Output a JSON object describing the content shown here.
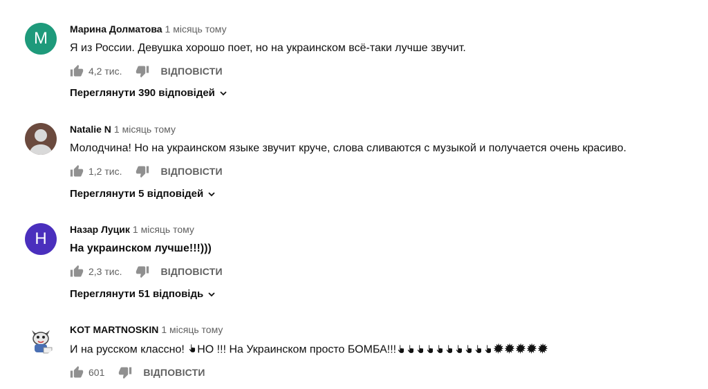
{
  "comments": [
    {
      "author": "Марина Долматова",
      "time": "1 місяць тому",
      "avatar_letter": "M",
      "avatar_color": "#1e9a7b",
      "text": "Я из России. Девушка хорошо поет, но на украинском всё-таки лучше звучит.",
      "likes": "4,2 тис.",
      "reply_label": "ВІДПОВІСТИ",
      "view_replies": "Переглянути 390 відповідей"
    },
    {
      "author": "Natalie N",
      "time": "1 місяць тому",
      "avatar_color": "#6b4a3e",
      "text": "Молодчина!  Но на украинском языке звучит круче, слова сливаются с музыкой и получается очень красиво.",
      "likes": "1,2 тис.",
      "reply_label": "ВІДПОВІСТИ",
      "view_replies": "Переглянути 5 відповідей"
    },
    {
      "author": "Назар Луцик",
      "time": "1 місяць тому",
      "avatar_letter": "H",
      "avatar_color": "#4a2fbd",
      "text": "На украинском лучше!!!)))",
      "likes": "2,3 тис.",
      "reply_label": "ВІДПОВІСТИ",
      "view_replies": "Переглянути 51 відповідь"
    },
    {
      "author": "KOT MARTNOSKIN",
      "time": "1 місяць тому",
      "text_before": "И на русском классно! ",
      "text_middle": "НО !!! На Украинском просто БОМБА!!!",
      "likes": "601",
      "reply_label": "ВІДПОВІСТИ"
    }
  ],
  "icons": {
    "like": "thumbs-up-icon",
    "dislike": "thumbs-down-icon",
    "chevron": "chevron-down-icon",
    "finger": "pointing-finger-icon",
    "explosion": "explosion-icon"
  },
  "colors": {
    "secondary_text": "#606060",
    "primary_text": "#0f0f0f"
  }
}
